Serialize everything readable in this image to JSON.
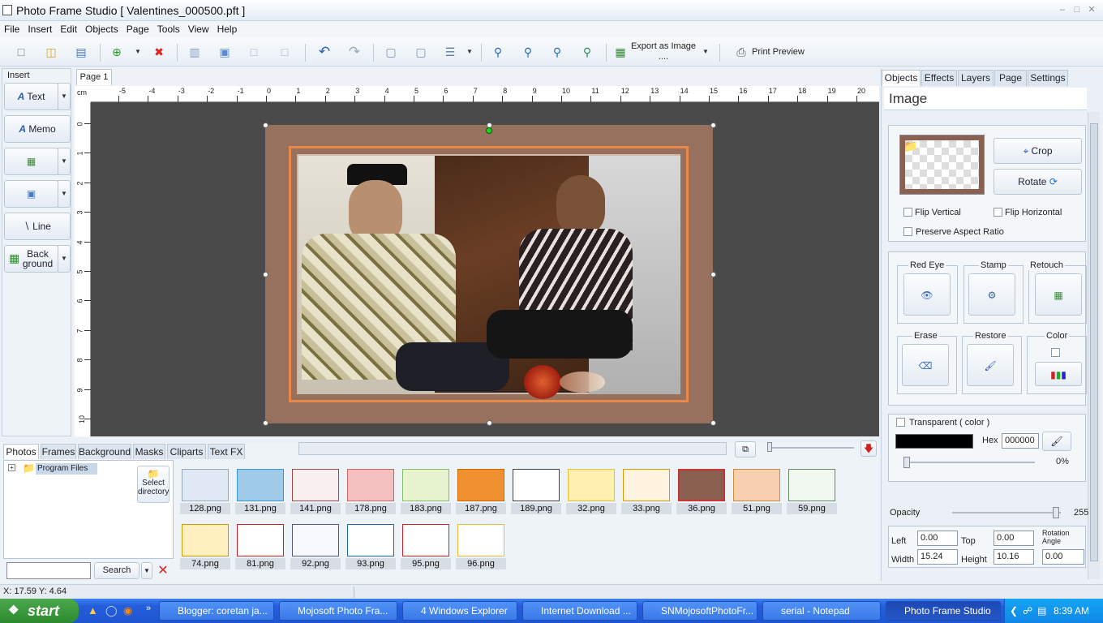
{
  "window": {
    "title": "Photo Frame Studio [ Valentines_000500.pft ]"
  },
  "menu": [
    "File",
    "Insert",
    "Edit",
    "Objects",
    "Page",
    "Tools",
    "View",
    "Help"
  ],
  "toolbar": {
    "export_label": "Export as Image",
    "export_sub": "....",
    "print_preview": "Print Preview"
  },
  "insert_panel": {
    "header": "Insert",
    "text": "Text",
    "memo": "Memo",
    "line": "Line",
    "background_1": "Back",
    "background_2": "ground"
  },
  "canvas": {
    "page_tab": "Page 1",
    "ruler_unit": "cm",
    "h_ticks": [
      "-5",
      "-4",
      "-3",
      "-2",
      "-1",
      "0",
      "1",
      "2",
      "3",
      "4",
      "5",
      "6",
      "7",
      "8",
      "9",
      "10",
      "11",
      "12",
      "13",
      "14",
      "15",
      "16",
      "17",
      "18",
      "19",
      "20"
    ],
    "v_ticks": [
      "0",
      "1",
      "2",
      "3",
      "4",
      "5",
      "6",
      "7",
      "8",
      "9",
      "10"
    ]
  },
  "right_panel": {
    "tabs": [
      "Objects",
      "Effects",
      "Layers",
      "Page",
      "Settings"
    ],
    "section_title": "Image",
    "crop": "Crop",
    "rotate": "Rotate",
    "flip_vertical": "Flip Vertical",
    "flip_horizontal": "Flip Horizontal",
    "preserve_aspect": "Preserve Aspect Ratio",
    "red_eye": "Red Eye",
    "stamp": "Stamp",
    "retouch": "Retouch",
    "erase": "Erase",
    "restore": "Restore",
    "color": "Color",
    "transparent": "Transparent ( color )",
    "hex_label": "Hex",
    "hex_value": "000000",
    "transparency_pct": "0%",
    "opacity_label": "Opacity",
    "opacity_value": "255",
    "left_label": "Left",
    "left_value": "0.00",
    "top_label": "Top",
    "top_value": "0.00",
    "rotation_label_1": "Rotation",
    "rotation_label_2": "Angle",
    "rotation_value": "0.00",
    "width_label": "Width",
    "width_value": "15.24",
    "height_label": "Height",
    "height_value": "10.16"
  },
  "bottom": {
    "tabs": [
      "Photos",
      "Frames",
      "Background",
      "Masks",
      "Cliparts",
      "Text FX"
    ],
    "tree_item": "Program Files",
    "select_dir_1": "Select",
    "select_dir_2": "directory",
    "search_button": "Search",
    "thumbs_row1": [
      "128.png",
      "131.png",
      "141.png",
      "178.png",
      "183.png",
      "187.png",
      "189.png",
      "32.png",
      "33.png",
      "36.png",
      "51.png",
      "59.png"
    ],
    "thumbs_row2": [
      "74.png",
      "81.png",
      "92.png",
      "93.png",
      "95.png",
      "96.png"
    ]
  },
  "status": {
    "coords": "X: 17.59 Y: 4.64"
  },
  "taskbar": {
    "start": "start",
    "items": [
      "Blogger: coretan ja...",
      "Mojosoft Photo Fra...",
      "4 Windows Explorer",
      "Internet Download ...",
      "SNMojosoftPhotoFr...",
      "serial - Notepad",
      "Photo Frame Studio"
    ],
    "clock": "8:39 AM"
  }
}
